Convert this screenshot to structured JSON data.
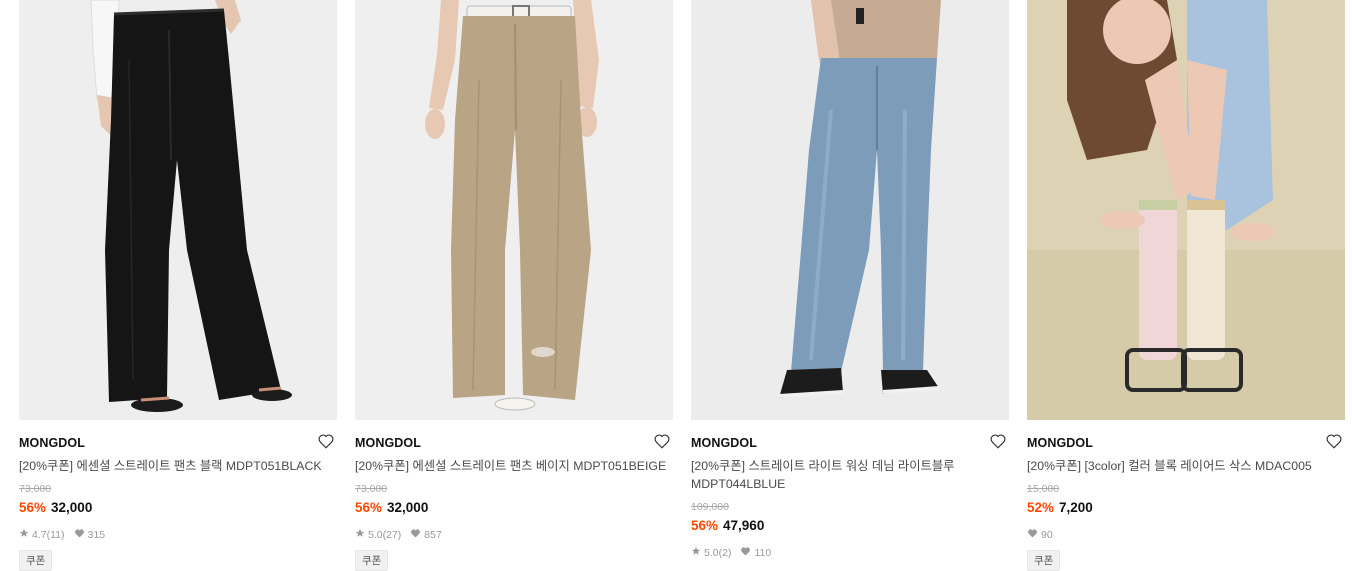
{
  "colors": {
    "discount": "#ff4800",
    "price": "#111111",
    "muted": "#999999"
  },
  "products": [
    {
      "brand": "MONGDOL",
      "name": "[20%쿠폰] 에센셜 스트레이트 팬츠 블랙 MDPT051BLACK",
      "original_price": "73,000",
      "discount": "56%",
      "price": "32,000",
      "rating": "4.7",
      "reviews": "(11)",
      "likes": "315",
      "tag": "쿠폰",
      "icons": [
        "heart-outline-icon",
        "star-icon",
        "heart-filled-icon"
      ]
    },
    {
      "brand": "MONGDOL",
      "name": "[20%쿠폰] 에센셜 스트레이트 팬츠 베이지 MDPT051BEIGE",
      "original_price": "73,000",
      "discount": "56%",
      "price": "32,000",
      "rating": "5.0",
      "reviews": "(27)",
      "likes": "857",
      "tag": "쿠폰",
      "icons": [
        "heart-outline-icon",
        "star-icon",
        "heart-filled-icon"
      ]
    },
    {
      "brand": "MONGDOL",
      "name": "[20%쿠폰] 스트레이트 라이트 워싱 데님 라이트블루 MDPT044LBLUE",
      "original_price": "109,000",
      "discount": "56%",
      "price": "47,960",
      "rating": "5.0",
      "reviews": "(2)",
      "likes": "110",
      "tag": "",
      "icons": [
        "heart-outline-icon",
        "star-icon",
        "heart-filled-icon"
      ]
    },
    {
      "brand": "MONGDOL",
      "name": "[20%쿠폰] [3color] 컬러 블록 레이어드 삭스 MDAC005",
      "original_price": "15,000",
      "discount": "52%",
      "price": "7,200",
      "rating": "",
      "reviews": "",
      "likes": "90",
      "tag": "쿠폰",
      "icons": [
        "heart-outline-icon",
        "heart-filled-icon"
      ]
    }
  ]
}
